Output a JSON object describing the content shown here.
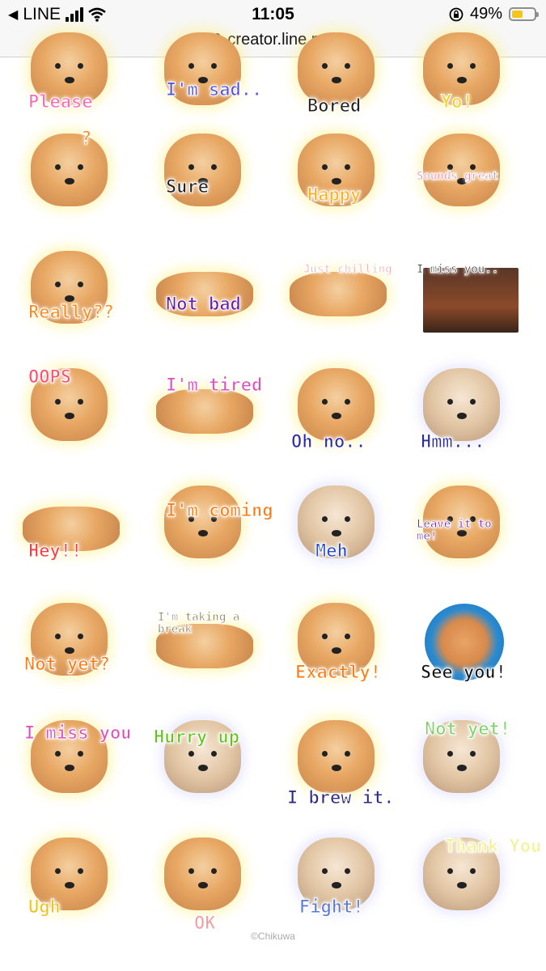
{
  "status_bar": {
    "back_app": "LINE",
    "time": "11:05",
    "battery_percent": "49%",
    "battery_level": 0.49,
    "icons": [
      "back-arrow-icon",
      "signal-icon",
      "wifi-icon",
      "orientation-lock-icon",
      "battery-icon"
    ]
  },
  "url_bar": {
    "domain": "creator.line.me",
    "icon": "lock-icon"
  },
  "stickers": [
    {
      "caption": "Please",
      "color": "#ff69b4"
    },
    {
      "caption": "I'm sad..",
      "color": "#5555dd"
    },
    {
      "caption": "Bored",
      "color": "#222222"
    },
    {
      "caption": "Yo!",
      "color": "#f0d21a"
    },
    {
      "caption": "?",
      "color": "#ff8c1a"
    },
    {
      "caption": "Sure",
      "color": "#222222"
    },
    {
      "caption": "Happy",
      "color": "#ffb020"
    },
    {
      "caption": "Sounds great",
      "color": "#e58aa8"
    },
    {
      "caption": "Really??",
      "color": "#ff8c1a"
    },
    {
      "caption": "Not bad",
      "color": "#6a1aa8"
    },
    {
      "caption": "Just chilling",
      "color": "#f3b0b8"
    },
    {
      "caption": "I miss you..",
      "color": "#333333"
    },
    {
      "caption": "OOPS",
      "color": "#ff4f6e"
    },
    {
      "caption": "I'm tired",
      "color": "#e04ec0"
    },
    {
      "caption": "Oh no..",
      "color": "#2a2aa8"
    },
    {
      "caption": "Hmm...",
      "color": "#2a2aa8"
    },
    {
      "caption": "Hey!!",
      "color": "#ff3a3a"
    },
    {
      "caption": "I'm coming",
      "color": "#ff7a10"
    },
    {
      "caption": "Meh",
      "color": "#2a4ad8"
    },
    {
      "caption": "Leave it to me!",
      "color": "#6a1aa8"
    },
    {
      "caption": "Not yet?",
      "color": "#ff7a10"
    },
    {
      "caption": "I'm taking a break",
      "color": "#8a7a50"
    },
    {
      "caption": "Exactly!",
      "color": "#ff7a10"
    },
    {
      "caption": "See you!",
      "color": "#111111"
    },
    {
      "caption": "I miss you",
      "color": "#e04ec0"
    },
    {
      "caption": "Hurry up",
      "color": "#5ec41a"
    },
    {
      "caption": "I brew it.",
      "color": "#2a2a8a"
    },
    {
      "caption": "Not yet!",
      "color": "#7ed36a"
    },
    {
      "caption": "Ugh",
      "color": "#f0c21a"
    },
    {
      "caption": "OK",
      "color": "#f0a0a0"
    },
    {
      "caption": "Fight!",
      "color": "#5a7ad8"
    },
    {
      "caption": "Thank You",
      "color": "#f4f08a"
    }
  ],
  "footer": {
    "copyright": "©Chikuwa"
  }
}
